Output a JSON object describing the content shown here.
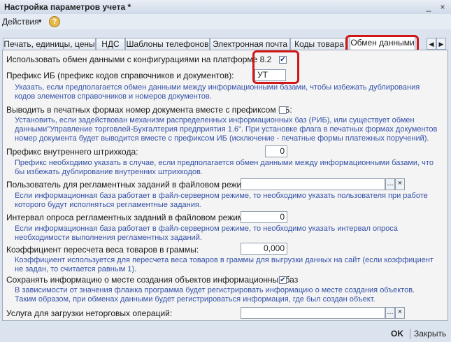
{
  "window": {
    "title": "Настройка параметров учета *"
  },
  "toolbar": {
    "actions_label": "Действия",
    "actions_arrow": "▾",
    "help_label": "?"
  },
  "tabs": [
    {
      "label": "Печать, единицы, цены"
    },
    {
      "label": "НДС"
    },
    {
      "label": "Шаблоны телефонов"
    },
    {
      "label": "Электронная почта"
    },
    {
      "label": "Коды товара"
    },
    {
      "label": "Обмен данными"
    }
  ],
  "fields": {
    "use_exchange": {
      "label": "Использовать обмен данными с конфигурациями на платформе 8.2",
      "checked": true
    },
    "prefix_ib": {
      "label": "Префикс ИБ (префикс кодов справочников и документов):",
      "value": "УТ",
      "hint": [
        "Указать, если предполагается обмен данными между информационными базами, чтобы избежать дублирования",
        "кодов элементов справочников и номеров документов."
      ]
    },
    "print_prefix": {
      "label": "Выводить в печатных формах номер документа вместе с префиксом ИБ:",
      "checked": false,
      "hint": [
        "Установить, если задействован механизм распределенных информационных баз (РИБ), или существует обмен",
        "данными\"Управление торговлей-Бухгалтерия предприятия 1.6\". При установке флага в печатных формах документов",
        "номер документа будет выводится вместе с префиксом ИБ (исключение - печатные формы платежных поручений)."
      ]
    },
    "barcode_prefix": {
      "label": "Префикс внутреннего штрихкода:",
      "value": "0",
      "hint": [
        "Префикс необходимо указать в случае, если предполагается обмен данными между информационными базами, что",
        "бы избежать дублирование внутренних штрихкодов."
      ]
    },
    "scheduled_user": {
      "label": "Пользователь для регламентных заданий в файловом режиме:",
      "value": "",
      "hint": [
        "Если информационная база работает в файл-серверном режиме, то необходимо указать пользователя при работе",
        "которого будут исполняться регламентные задания."
      ]
    },
    "poll_interval": {
      "label": "Интервал опроса регламентных заданий в файловом режиме:",
      "value": "0",
      "hint": [
        "Если информационная база работает в файл-серверном режиме, то необходимо указать интервал опроса",
        "необходимости выполнения регламентных заданий."
      ]
    },
    "weight_coef": {
      "label": "Коэффициент пересчета веса товаров в граммы:",
      "value": "0,000",
      "hint": [
        "Коэффициент используется для пересчета веса товаров в граммы для выгрузки данных на сайт (если коэффициент",
        "не задан, то считается равным 1)."
      ]
    },
    "save_origin": {
      "label": "Сохранять информацию о месте создания объектов информационных баз",
      "checked": true,
      "hint": [
        "В зависимости от значения флажка программа будет регистрировать информацию о месте создания объектов.",
        "Таким образом, при обменах данными будет регистрироваться информация, где был создан объект."
      ]
    },
    "upload_service": {
      "label": "Услуга для загрузки неторговых операций:",
      "value": ""
    }
  },
  "footer": {
    "ok_label": "OK",
    "close_label": "Закрыть"
  },
  "icons": {
    "check": "✔",
    "ellipsis": "...",
    "clear": "×",
    "nav_left": "◀",
    "nav_right": "▶",
    "minimize": "_",
    "close": "×"
  },
  "colors": {
    "highlight": "#d01818",
    "hint_text": "#3552a7"
  }
}
